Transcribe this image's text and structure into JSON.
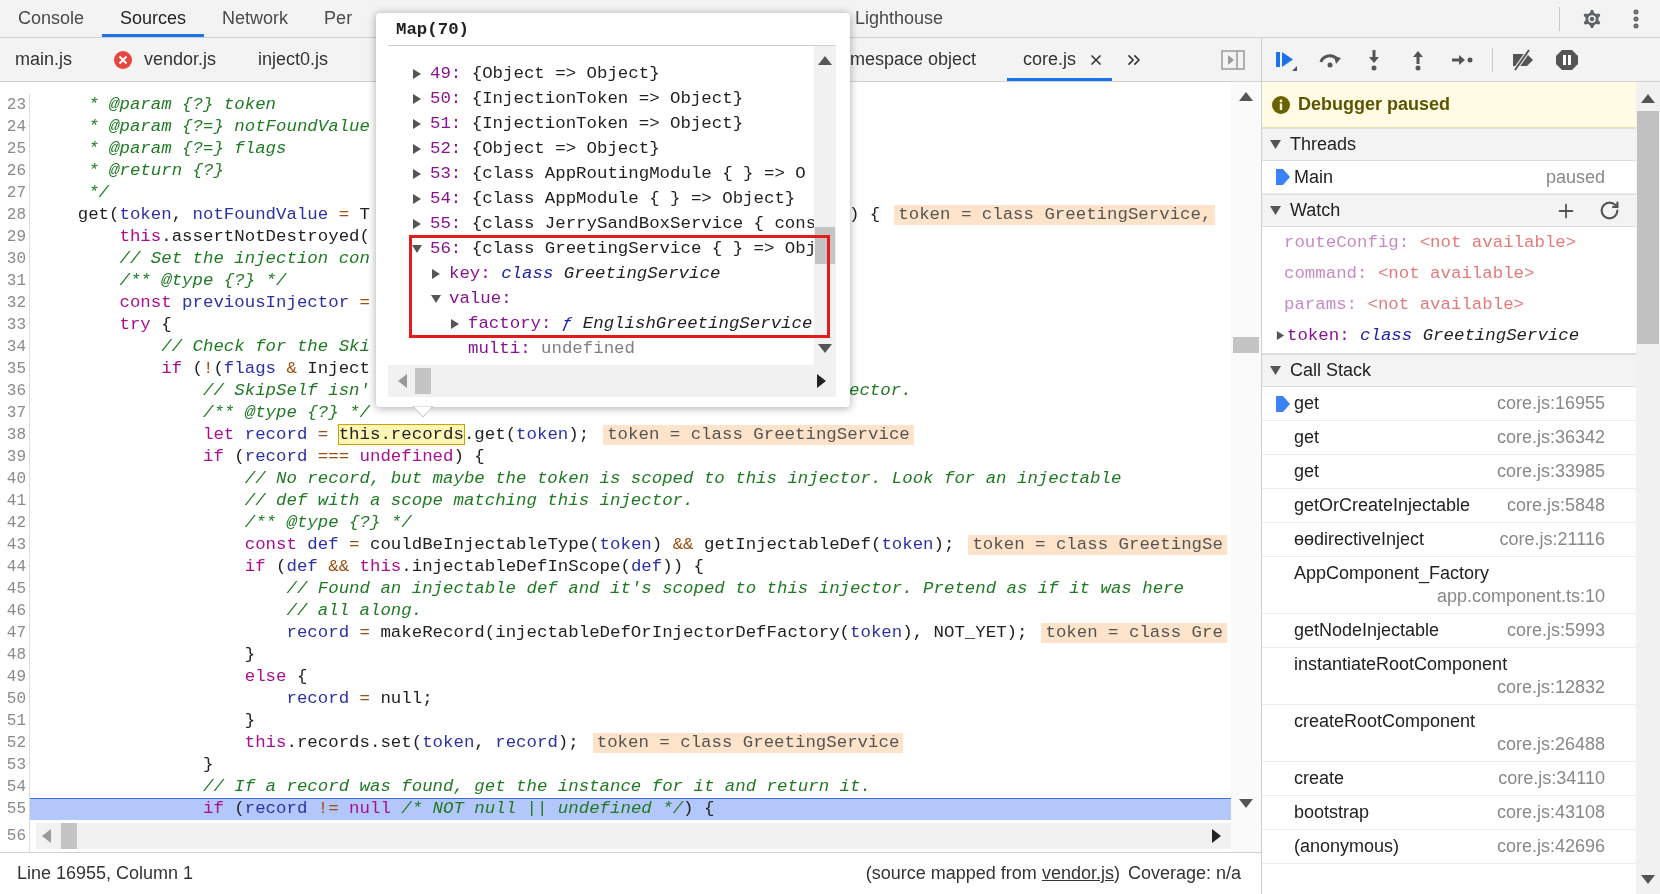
{
  "panel_tabs": [
    {
      "label": "Console",
      "selected": false
    },
    {
      "label": "Sources",
      "selected": true
    },
    {
      "label": "Network",
      "selected": false
    },
    {
      "label": "Per",
      "selected": false
    }
  ],
  "panel_tabs_right": [
    {
      "label": "Lighthouse",
      "selected": false
    }
  ],
  "file_tabs": [
    {
      "label": "main.js",
      "selected": false,
      "error": false
    },
    {
      "label": "vendor.js",
      "selected": false,
      "error": true
    },
    {
      "label": "inject0.js",
      "selected": false,
      "error": false
    }
  ],
  "file_tabs_right": [
    {
      "label": "mespace object",
      "selected": false,
      "closable": false
    },
    {
      "label": "core.js",
      "selected": true,
      "closable": true
    }
  ],
  "editor": {
    "lines": [
      {
        "n": "23",
        "current": false,
        "segs": [
          {
            "kind": "com",
            "text": "     * @param {?} token"
          }
        ]
      },
      {
        "n": "24",
        "current": false,
        "segs": [
          {
            "kind": "com",
            "text": "     * @param {?=} notFoundValue"
          }
        ]
      },
      {
        "n": "25",
        "current": false,
        "segs": [
          {
            "kind": "com",
            "text": "     * @param {?=} flags"
          }
        ]
      },
      {
        "n": "26",
        "current": false,
        "segs": [
          {
            "kind": "com",
            "text": "     * @return {?}"
          }
        ]
      },
      {
        "n": "27",
        "current": false,
        "segs": [
          {
            "kind": "com",
            "text": "     */"
          }
        ]
      },
      {
        "n": "28",
        "current": false,
        "segs": [
          {
            "kind": "plain",
            "text": "    get("
          },
          {
            "kind": "var",
            "text": "token"
          },
          {
            "kind": "plain",
            "text": ", "
          },
          {
            "kind": "var",
            "text": "notFoundValue"
          },
          {
            "kind": "op",
            "text": " = "
          },
          {
            "kind": "plain",
            "text": "T"
          }
        ],
        "after": [
          {
            "kind": "plain",
            "text": ") {"
          }
        ],
        "value": "token = class GreetingService,"
      },
      {
        "n": "29",
        "current": false,
        "segs": [
          {
            "kind": "kw",
            "text": "        this"
          },
          {
            "kind": "plain",
            "text": ".assertNotDestroyed("
          }
        ]
      },
      {
        "n": "30",
        "current": false,
        "segs": [
          {
            "kind": "com",
            "text": "        // Set the injection con"
          }
        ]
      },
      {
        "n": "31",
        "current": false,
        "segs": [
          {
            "kind": "com",
            "text": "        /** @type {?} */"
          }
        ]
      },
      {
        "n": "32",
        "current": false,
        "segs": [
          {
            "kind": "kw",
            "text": "        const "
          },
          {
            "kind": "var",
            "text": "previousInjector"
          },
          {
            "kind": "op",
            "text": " ="
          }
        ]
      },
      {
        "n": "33",
        "current": false,
        "segs": [
          {
            "kind": "kw",
            "text": "        try"
          },
          {
            "kind": "plain",
            "text": " {"
          }
        ]
      },
      {
        "n": "34",
        "current": false,
        "segs": [
          {
            "kind": "com",
            "text": "            // Check for the Ski"
          }
        ]
      },
      {
        "n": "35",
        "current": false,
        "segs": [
          {
            "kind": "kw",
            "text": "            if"
          },
          {
            "kind": "plain",
            "text": " ("
          },
          {
            "kind": "op",
            "text": "!"
          },
          {
            "kind": "plain",
            "text": "("
          },
          {
            "kind": "var",
            "text": "flags"
          },
          {
            "kind": "op",
            "text": " & "
          },
          {
            "kind": "plain",
            "text": "Inject"
          }
        ]
      },
      {
        "n": "36",
        "current": false,
        "segs": [
          {
            "kind": "com",
            "text": "                // SkipSelf isn'"
          }
        ],
        "after": [
          {
            "kind": "com",
            "text": "ector."
          }
        ]
      },
      {
        "n": "37",
        "current": false,
        "segs": [
          {
            "kind": "com",
            "text": "                /** @type {?} */"
          }
        ]
      },
      {
        "n": "38",
        "current": false,
        "segs": [
          {
            "kind": "kw",
            "text": "                let "
          },
          {
            "kind": "var",
            "text": "record"
          },
          {
            "kind": "op",
            "text": " = "
          },
          {
            "kind": "hover",
            "text": "this.records"
          },
          {
            "kind": "plain",
            "text": ".get("
          },
          {
            "kind": "var",
            "text": "token"
          },
          {
            "kind": "plain",
            "text": ");"
          }
        ],
        "value": "token = class GreetingService"
      },
      {
        "n": "39",
        "current": false,
        "segs": [
          {
            "kind": "kw",
            "text": "                if"
          },
          {
            "kind": "plain",
            "text": " ("
          },
          {
            "kind": "var",
            "text": "record"
          },
          {
            "kind": "op",
            "text": " === "
          },
          {
            "kind": "kw",
            "text": "undefined"
          },
          {
            "kind": "plain",
            "text": ") {"
          }
        ]
      },
      {
        "n": "40",
        "current": false,
        "segs": [
          {
            "kind": "com",
            "text": "                    // No record, but maybe the token is scoped to this injector. Look for an injectable"
          }
        ]
      },
      {
        "n": "41",
        "current": false,
        "segs": [
          {
            "kind": "com",
            "text": "                    // def with a scope matching this injector."
          }
        ]
      },
      {
        "n": "42",
        "current": false,
        "segs": [
          {
            "kind": "com",
            "text": "                    /** @type {?} */"
          }
        ]
      },
      {
        "n": "43",
        "current": false,
        "segs": [
          {
            "kind": "kw",
            "text": "                    const "
          },
          {
            "kind": "var",
            "text": "def"
          },
          {
            "kind": "op",
            "text": " = "
          },
          {
            "kind": "plain",
            "text": "couldBeInjectableType("
          },
          {
            "kind": "var",
            "text": "token"
          },
          {
            "kind": "plain",
            "text": ") "
          },
          {
            "kind": "op",
            "text": "&&"
          },
          {
            "kind": "plain",
            "text": " getInjectableDef("
          },
          {
            "kind": "var",
            "text": "token"
          },
          {
            "kind": "plain",
            "text": ");"
          }
        ],
        "value": "token = class GreetingSe"
      },
      {
        "n": "44",
        "current": false,
        "segs": [
          {
            "kind": "kw",
            "text": "                    if"
          },
          {
            "kind": "plain",
            "text": " ("
          },
          {
            "kind": "var",
            "text": "def"
          },
          {
            "kind": "op",
            "text": " && "
          },
          {
            "kind": "kw",
            "text": "this"
          },
          {
            "kind": "plain",
            "text": ".injectableDefInScope("
          },
          {
            "kind": "var",
            "text": "def"
          },
          {
            "kind": "plain",
            "text": ")) {"
          }
        ]
      },
      {
        "n": "45",
        "current": false,
        "segs": [
          {
            "kind": "com",
            "text": "                        // Found an injectable def and it's scoped to this injector. Pretend as if it was here"
          }
        ]
      },
      {
        "n": "46",
        "current": false,
        "segs": [
          {
            "kind": "com",
            "text": "                        // all along."
          }
        ]
      },
      {
        "n": "47",
        "current": false,
        "segs": [
          {
            "kind": "var",
            "text": "                        record"
          },
          {
            "kind": "op",
            "text": " = "
          },
          {
            "kind": "plain",
            "text": "makeRecord(injectableDefOrInjectorDefFactory("
          },
          {
            "kind": "var",
            "text": "token"
          },
          {
            "kind": "plain",
            "text": "), NOT_YET);"
          }
        ],
        "value": "token = class Gre"
      },
      {
        "n": "48",
        "current": false,
        "segs": [
          {
            "kind": "plain",
            "text": "                    }"
          }
        ]
      },
      {
        "n": "49",
        "current": false,
        "segs": [
          {
            "kind": "kw",
            "text": "                    else"
          },
          {
            "kind": "plain",
            "text": " {"
          }
        ]
      },
      {
        "n": "50",
        "current": false,
        "segs": [
          {
            "kind": "var",
            "text": "                        record"
          },
          {
            "kind": "op",
            "text": " = "
          },
          {
            "kind": "plain",
            "text": "null;"
          }
        ]
      },
      {
        "n": "51",
        "current": false,
        "segs": [
          {
            "kind": "plain",
            "text": "                    }"
          }
        ]
      },
      {
        "n": "52",
        "current": false,
        "segs": [
          {
            "kind": "kw",
            "text": "                    this"
          },
          {
            "kind": "plain",
            "text": ".records.set("
          },
          {
            "kind": "var",
            "text": "token"
          },
          {
            "kind": "plain",
            "text": ", "
          },
          {
            "kind": "var",
            "text": "record"
          },
          {
            "kind": "plain",
            "text": ");"
          }
        ],
        "value": "token = class GreetingService"
      },
      {
        "n": "53",
        "current": false,
        "segs": [
          {
            "kind": "plain",
            "text": "                }"
          }
        ]
      },
      {
        "n": "54",
        "current": false,
        "segs": [
          {
            "kind": "com",
            "text": "                // If a record was found, get the instance for it and return it."
          }
        ]
      },
      {
        "n": "55",
        "current": true,
        "segs": [
          {
            "kind": "kw",
            "text": "                if"
          },
          {
            "kind": "plain",
            "text": " ("
          },
          {
            "kind": "var",
            "text": "record"
          },
          {
            "kind": "op",
            "text": " != "
          },
          {
            "kind": "kw",
            "text": "null "
          },
          {
            "kind": "com",
            "text": "/* NOT null || undefined */"
          },
          {
            "kind": "plain",
            "text": ") {"
          }
        ]
      }
    ],
    "last_line_number": "56"
  },
  "popup": {
    "title": "Map(70)",
    "highlight_frame": true,
    "entries": [
      {
        "index": "49:",
        "text": "{Object => Object}",
        "expanded": false
      },
      {
        "index": "50:",
        "text": "{InjectionToken => Object}",
        "expanded": false
      },
      {
        "index": "51:",
        "text": "{InjectionToken => Object}",
        "expanded": false
      },
      {
        "index": "52:",
        "text": "{Object => Object}",
        "expanded": false
      },
      {
        "index": "53:",
        "text": "{class AppRoutingModule { } => O",
        "expanded": false
      },
      {
        "index": "54:",
        "text": "{class AppModule { } => Object}",
        "expanded": false
      },
      {
        "index": "55:",
        "text": "{class JerrySandBoxService { cons",
        "expanded": false
      },
      {
        "index": "56:",
        "text": "{class GreetingService { } => Obj",
        "expanded": true,
        "children": [
          {
            "kind": "node",
            "key": "key:",
            "prefix": "class",
            "value": "GreetingService",
            "expanded": false
          },
          {
            "kind": "node",
            "key": "value:",
            "expanded": true,
            "children": [
              {
                "kind": "node",
                "key": "factory:",
                "prefix": "ƒ",
                "value": "EnglishGreetingService",
                "expanded": false
              },
              {
                "kind": "leaf",
                "key": "multi:",
                "value": "undefined"
              }
            ]
          }
        ]
      }
    ]
  },
  "status_bar": {
    "position": "Line 16955, Column 1",
    "source_prefix": "(source mapped from",
    "source_link": "vendor.js",
    "source_suffix": ")",
    "coverage": "Coverage: n/a"
  },
  "paused_banner": "Debugger paused",
  "threads": {
    "title": "Threads",
    "expanded": true,
    "items": [
      {
        "name": "Main",
        "status": "paused",
        "selected": true
      }
    ]
  },
  "watch": {
    "title": "Watch",
    "expanded": true,
    "items": [
      {
        "kind": "unavailable",
        "name": "routeConfig:",
        "value": "<not available>"
      },
      {
        "kind": "unavailable",
        "name": "command:",
        "value": "<not available>"
      },
      {
        "kind": "unavailable",
        "name": "params:",
        "value": "<not available>"
      },
      {
        "kind": "object",
        "name": "token:",
        "prefix": "class",
        "value": "GreetingService",
        "expanded": false
      }
    ]
  },
  "call_stack": {
    "title": "Call Stack",
    "expanded": true,
    "frames": [
      {
        "name": "get",
        "location": "core.js:16955",
        "selected": true
      },
      {
        "name": "get",
        "location": "core.js:36342",
        "selected": false
      },
      {
        "name": "get",
        "location": "core.js:33985",
        "selected": false
      },
      {
        "name": "getOrCreateInjectable",
        "location": "core.js:5848",
        "selected": false
      },
      {
        "name": "ɵɵdirectiveInject",
        "location": "core.js:21116",
        "selected": false
      },
      {
        "name": "AppComponent_Factory",
        "location": "app.component.ts:10",
        "selected": false
      },
      {
        "name": "getNodeInjectable",
        "location": "core.js:5993",
        "selected": false
      },
      {
        "name": "instantiateRootComponent",
        "location": "core.js:12832",
        "selected": false
      },
      {
        "name": "createRootComponent",
        "location": "core.js:26488",
        "selected": false
      },
      {
        "name": "create",
        "location": "core.js:34110",
        "selected": false
      },
      {
        "name": "bootstrap",
        "location": "core.js:43108",
        "selected": false
      },
      {
        "name": "(anonymous)",
        "location": "core.js:42696",
        "selected": false
      }
    ]
  }
}
